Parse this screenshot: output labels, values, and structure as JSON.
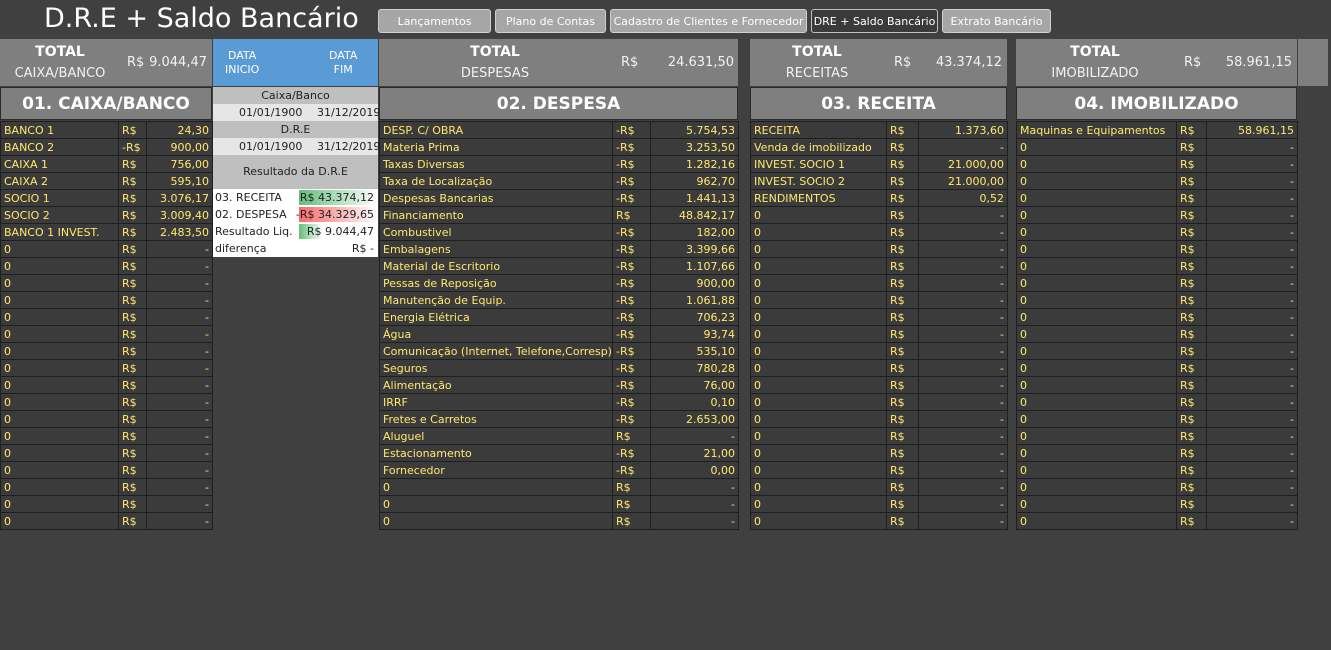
{
  "title": "D.R.E + Saldo Bancário",
  "nav": [
    "Lançamentos",
    "Plano de Contas",
    "Cadastro de Clientes  e Fornecedor",
    "DRE + Saldo Bancário",
    "Extrato Bancário"
  ],
  "totals": {
    "caixa": {
      "label1": "TOTAL",
      "label2": "CAIXA/BANCO",
      "cur": "R$",
      "value": "9.044,47"
    },
    "despesas": {
      "label1": "TOTAL",
      "label2": "DESPESAS",
      "cur": "R$",
      "value": "24.631,50"
    },
    "receitas": {
      "label1": "TOTAL",
      "label2": "RECEITAS",
      "cur": "R$",
      "value": "43.374,12"
    },
    "imobilizado": {
      "label1": "TOTAL",
      "label2": "IMOBILIZADO",
      "cur": "R$",
      "value": "58.961,15"
    }
  },
  "dates": {
    "inicio_label1": "DATA",
    "inicio_label2": "INICIO",
    "fim_label1": "DATA",
    "fim_label2": "FIM",
    "caixa_banco": "Caixa/Banco",
    "caixa_inicio": "01/01/1900",
    "caixa_fim": "31/12/2019",
    "dre": "D.R.E",
    "dre_inicio": "01/01/1900",
    "dre_fim": "31/12/2019",
    "resultado": "Resultado da D.R.E"
  },
  "resultado": [
    {
      "label": "03. RECEITA",
      "value": "R$  43.374,12",
      "color": "#63be7b",
      "frac": 1.0
    },
    {
      "label": "02. DESPESA",
      "value": "-R$  34.329,65",
      "color": "#f8696b",
      "frac": 1.0
    },
    {
      "label": "Resultado Liq.",
      "value": "R$    9.044,47",
      "color": "#63be7b",
      "frac": 0.3
    },
    {
      "label": "diferença",
      "value": "R$         -",
      "color": "",
      "frac": 0
    }
  ],
  "sections": {
    "caixa": "01. CAIXA/BANCO",
    "despesa": "02. DESPESA",
    "receita": "03. RECEITA",
    "imobilizado": "04. IMOBILIZADO"
  },
  "caixa_rows": [
    [
      "BANCO 1",
      "R$",
      "24,30"
    ],
    [
      "BANCO 2",
      "-R$",
      "900,00"
    ],
    [
      "CAIXA 1",
      "R$",
      "756,00"
    ],
    [
      "CAIXA 2",
      "R$",
      "595,10"
    ],
    [
      "SOCIO 1",
      "R$",
      "3.076,17"
    ],
    [
      "SOCIO 2",
      "R$",
      "3.009,40"
    ],
    [
      "BANCO 1 INVEST.",
      "R$",
      "2.483,50"
    ],
    [
      "0",
      "R$",
      "-"
    ],
    [
      "0",
      "R$",
      "-"
    ],
    [
      "0",
      "R$",
      "-"
    ],
    [
      "0",
      "R$",
      "-"
    ],
    [
      "0",
      "R$",
      "-"
    ],
    [
      "0",
      "R$",
      "-"
    ],
    [
      "0",
      "R$",
      "-"
    ],
    [
      "0",
      "R$",
      "-"
    ],
    [
      "0",
      "R$",
      "-"
    ],
    [
      "0",
      "R$",
      "-"
    ],
    [
      "0",
      "R$",
      "-"
    ],
    [
      "0",
      "R$",
      "-"
    ],
    [
      "0",
      "R$",
      "-"
    ],
    [
      "0",
      "R$",
      "-"
    ],
    [
      "0",
      "R$",
      "-"
    ],
    [
      "0",
      "R$",
      "-"
    ],
    [
      "0",
      "R$",
      "-"
    ]
  ],
  "despesa_rows": [
    [
      "DESP. C/ OBRA",
      "-R$",
      "5.754,53"
    ],
    [
      "Materia Prima",
      "-R$",
      "3.253,50"
    ],
    [
      "Taxas Diversas",
      "-R$",
      "1.282,16"
    ],
    [
      "Taxa de Localização",
      "-R$",
      "962,70"
    ],
    [
      "Despesas Bancarias",
      "-R$",
      "1.441,13"
    ],
    [
      "Financiamento",
      "R$",
      "48.842,17"
    ],
    [
      "Combustivel",
      "-R$",
      "182,00"
    ],
    [
      "Embalagens",
      "-R$",
      "3.399,66"
    ],
    [
      "Material de Escritorio",
      "-R$",
      "1.107,66"
    ],
    [
      "Pessas de Reposição",
      "-R$",
      "900,00"
    ],
    [
      "Manutenção de Equip.",
      "-R$",
      "1.061,88"
    ],
    [
      "Energia Elétrica",
      "-R$",
      "706,23"
    ],
    [
      "Água",
      "-R$",
      "93,74"
    ],
    [
      "Comunicação (Internet, Telefone,Corresp)",
      "-R$",
      "535,10"
    ],
    [
      "Seguros",
      "-R$",
      "780,28"
    ],
    [
      "Alimentação",
      "-R$",
      "76,00"
    ],
    [
      "IRRF",
      "-R$",
      "0,10"
    ],
    [
      "Fretes e Carretos",
      "-R$",
      "2.653,00"
    ],
    [
      "Aluguel",
      "R$",
      "-"
    ],
    [
      "Estacionamento",
      "-R$",
      "21,00"
    ],
    [
      "Fornecedor",
      "-R$",
      "0,00"
    ],
    [
      "0",
      "R$",
      "-"
    ],
    [
      "0",
      "R$",
      "-"
    ],
    [
      "0",
      "R$",
      "-"
    ]
  ],
  "receita_rows": [
    [
      "RECEITA",
      "R$",
      "1.373,60"
    ],
    [
      "Venda de imobilizado",
      "R$",
      "-"
    ],
    [
      "INVEST. SOCIO 1",
      "R$",
      "21.000,00"
    ],
    [
      "INVEST. SOCIO 2",
      "R$",
      "21.000,00"
    ],
    [
      "RENDIMENTOS",
      "R$",
      "0,52"
    ],
    [
      "0",
      "R$",
      "-"
    ],
    [
      "0",
      "R$",
      "-"
    ],
    [
      "0",
      "R$",
      "-"
    ],
    [
      "0",
      "R$",
      "-"
    ],
    [
      "0",
      "R$",
      "-"
    ],
    [
      "0",
      "R$",
      "-"
    ],
    [
      "0",
      "R$",
      "-"
    ],
    [
      "0",
      "R$",
      "-"
    ],
    [
      "0",
      "R$",
      "-"
    ],
    [
      "0",
      "R$",
      "-"
    ],
    [
      "0",
      "R$",
      "-"
    ],
    [
      "0",
      "R$",
      "-"
    ],
    [
      "0",
      "R$",
      "-"
    ],
    [
      "0",
      "R$",
      "-"
    ],
    [
      "0",
      "R$",
      "-"
    ],
    [
      "0",
      "R$",
      "-"
    ],
    [
      "0",
      "R$",
      "-"
    ],
    [
      "0",
      "R$",
      "-"
    ],
    [
      "0",
      "R$",
      "-"
    ]
  ],
  "imobilizado_rows": [
    [
      "Maquinas e Equipamentos",
      "R$",
      "58.961,15"
    ],
    [
      "0",
      "R$",
      "-"
    ],
    [
      "0",
      "R$",
      "-"
    ],
    [
      "0",
      "R$",
      "-"
    ],
    [
      "0",
      "R$",
      "-"
    ],
    [
      "0",
      "R$",
      "-"
    ],
    [
      "0",
      "R$",
      "-"
    ],
    [
      "0",
      "R$",
      "-"
    ],
    [
      "0",
      "R$",
      "-"
    ],
    [
      "0",
      "R$",
      "-"
    ],
    [
      "0",
      "R$",
      "-"
    ],
    [
      "0",
      "R$",
      "-"
    ],
    [
      "0",
      "R$",
      "-"
    ],
    [
      "0",
      "R$",
      "-"
    ],
    [
      "0",
      "R$",
      "-"
    ],
    [
      "0",
      "R$",
      "-"
    ],
    [
      "0",
      "R$",
      "-"
    ],
    [
      "0",
      "R$",
      "-"
    ],
    [
      "0",
      "R$",
      "-"
    ],
    [
      "0",
      "R$",
      "-"
    ],
    [
      "0",
      "R$",
      "-"
    ],
    [
      "0",
      "R$",
      "-"
    ],
    [
      "0",
      "R$",
      "-"
    ],
    [
      "0",
      "R$",
      "-"
    ]
  ]
}
